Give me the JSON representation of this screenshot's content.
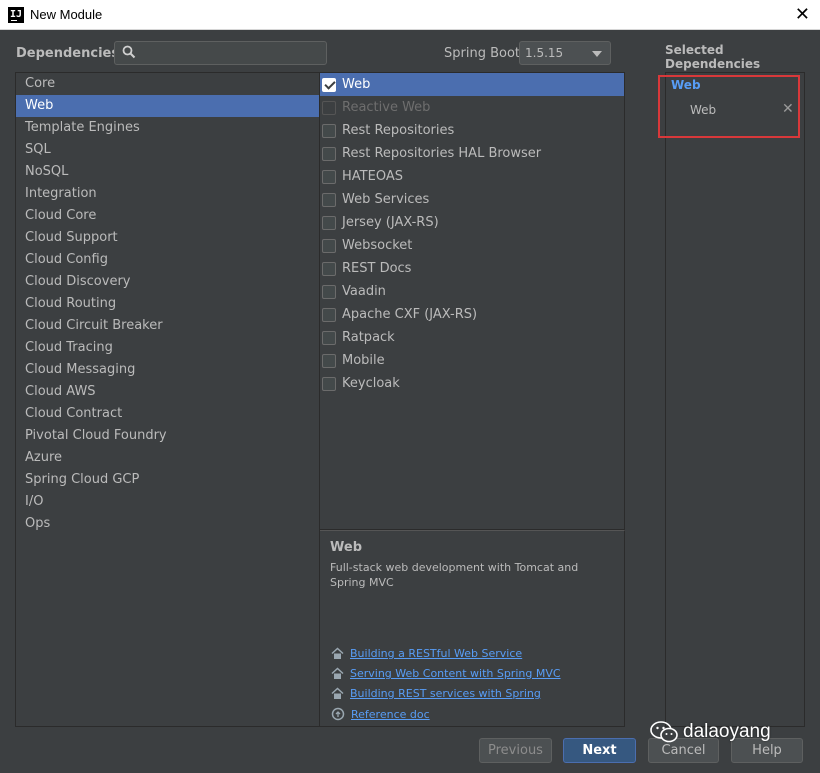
{
  "window": {
    "title": "New Module"
  },
  "header": {
    "dependencies_label": "Dependencies",
    "search": {
      "value": "",
      "placeholder": ""
    },
    "spring_boot_label": "Spring Boot",
    "spring_boot_version": "1.5.15",
    "selected_dependencies_label": "Selected Dependencies"
  },
  "categories": [
    "Core",
    "Web",
    "Template Engines",
    "SQL",
    "NoSQL",
    "Integration",
    "Cloud Core",
    "Cloud Support",
    "Cloud Config",
    "Cloud Discovery",
    "Cloud Routing",
    "Cloud Circuit Breaker",
    "Cloud Tracing",
    "Cloud Messaging",
    "Cloud AWS",
    "Cloud Contract",
    "Pivotal Cloud Foundry",
    "Azure",
    "Spring Cloud GCP",
    "I/O",
    "Ops"
  ],
  "selected_category": "Web",
  "dependencies": [
    {
      "label": "Web",
      "checked": true,
      "enabled": true
    },
    {
      "label": "Reactive Web",
      "checked": false,
      "enabled": false
    },
    {
      "label": "Rest Repositories",
      "checked": false,
      "enabled": true
    },
    {
      "label": "Rest Repositories HAL Browser",
      "checked": false,
      "enabled": true
    },
    {
      "label": "HATEOAS",
      "checked": false,
      "enabled": true
    },
    {
      "label": "Web Services",
      "checked": false,
      "enabled": true
    },
    {
      "label": "Jersey (JAX-RS)",
      "checked": false,
      "enabled": true
    },
    {
      "label": "Websocket",
      "checked": false,
      "enabled": true
    },
    {
      "label": "REST Docs",
      "checked": false,
      "enabled": true
    },
    {
      "label": "Vaadin",
      "checked": false,
      "enabled": true
    },
    {
      "label": "Apache CXF (JAX-RS)",
      "checked": false,
      "enabled": true
    },
    {
      "label": "Ratpack",
      "checked": false,
      "enabled": true
    },
    {
      "label": "Mobile",
      "checked": false,
      "enabled": true
    },
    {
      "label": "Keycloak",
      "checked": false,
      "enabled": true
    }
  ],
  "description": {
    "title": "Web",
    "text": "Full-stack web development with Tomcat and Spring MVC",
    "links": [
      {
        "label": "Building a RESTful Web Service",
        "icon": "home-icon"
      },
      {
        "label": "Serving Web Content with Spring MVC",
        "icon": "home-icon"
      },
      {
        "label": "Building REST services with Spring",
        "icon": "home-icon"
      },
      {
        "label": "Reference doc",
        "icon": "reference-doc-icon"
      }
    ]
  },
  "selected": {
    "category": "Web",
    "items": [
      {
        "label": "Web",
        "remove_glyph": "✕"
      }
    ]
  },
  "buttons": {
    "previous": "Previous",
    "next": "Next",
    "cancel": "Cancel",
    "help": "Help"
  },
  "watermark": {
    "text": "dalaoyang"
  },
  "colors": {
    "selection": "#4b6eaf",
    "link": "#589df6",
    "highlight_box": "#d9383a",
    "background": "#3c3f41"
  }
}
